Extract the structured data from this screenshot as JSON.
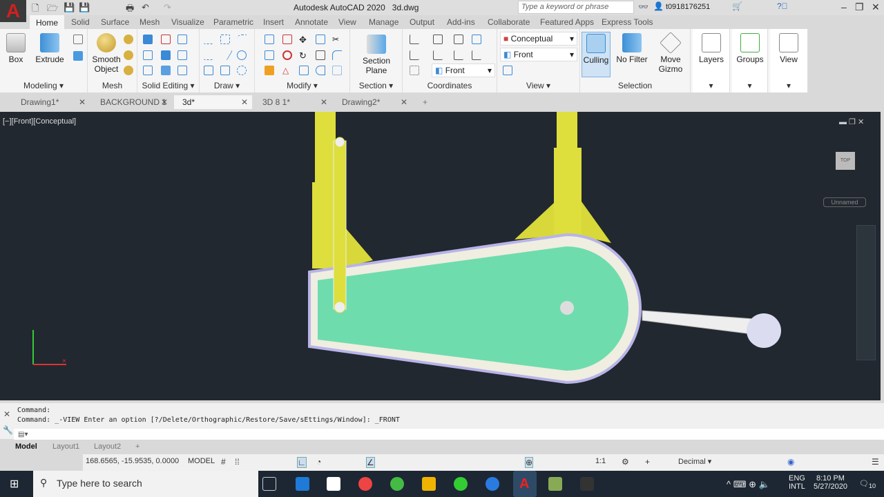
{
  "app": {
    "title": "Autodesk AutoCAD 2020",
    "file": "3d.dwg",
    "logo": "A",
    "search_placeholder": "Type a keyword or phrase",
    "user": "t0918176251"
  },
  "ribbon_tabs": [
    "Home",
    "Solid",
    "Surface",
    "Mesh",
    "Visualize",
    "Parametric",
    "Insert",
    "Annotate",
    "View",
    "Manage",
    "Output",
    "Add-ins",
    "Collaborate",
    "Featured Apps",
    "Express Tools"
  ],
  "panels": {
    "modeling": "Modeling",
    "mesh": "Mesh",
    "solid_editing": "Solid Editing",
    "draw": "Draw",
    "modify": "Modify",
    "section": "Section",
    "coordinates": "Coordinates",
    "view": "View",
    "selection": "Selection"
  },
  "buttons": {
    "box": "Box",
    "extrude": "Extrude",
    "smooth": "Smooth",
    "object": "Object",
    "section": "Section",
    "plane": "Plane",
    "culling": "Culling",
    "no_filter": "No Filter",
    "move": "Move",
    "gizmo": "Gizmo",
    "layers": "Layers",
    "groups": "Groups",
    "view": "View"
  },
  "dropdowns": {
    "visual_style": "Conceptual",
    "view": "Front",
    "ucs": "Front"
  },
  "file_tabs": [
    "Drawing1*",
    "BACKGROUND 1",
    "3d*",
    "3D 8 1*",
    "Drawing2*"
  ],
  "viewport": {
    "label": "[−][Front][Conceptual]",
    "viewcube": "TOP",
    "ucs_name": "Unnamed"
  },
  "command": {
    "line1": "Command:",
    "line2": "Command: _-VIEW Enter an option [?/Delete/Orthographic/Restore/Save/sEttings/Window]: _FRONT"
  },
  "layout_tabs": [
    "Model",
    "Layout1",
    "Layout2",
    "+"
  ],
  "status": {
    "coords": "168.6565, -15.9535, 0.0000",
    "space": "MODEL",
    "scale": "1:1",
    "units": "Decimal"
  },
  "taskbar": {
    "search": "Type here to search",
    "lang1": "ENG",
    "lang2": "INTL",
    "time": "8:10 PM",
    "date": "5/27/2020",
    "notif": "10"
  },
  "colors": {
    "viewport": "#212830",
    "face": "#6fdcae",
    "yellow": "#dede3c"
  }
}
